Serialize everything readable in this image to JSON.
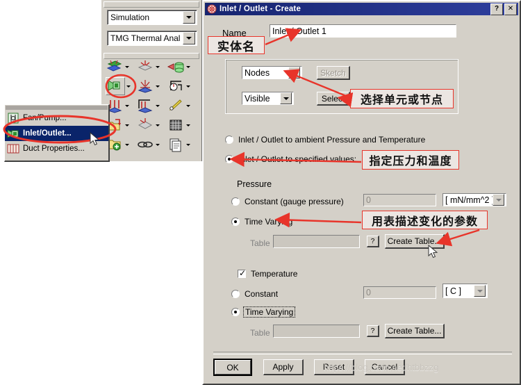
{
  "background_app": {
    "selector_combos": [
      {
        "name": "application-combo",
        "value": "Simulation"
      },
      {
        "name": "solver-combo",
        "value": "TMG Thermal Anal"
      }
    ],
    "toolbar_icons": [
      "thermal-coupling-icon",
      "radiation-icon",
      "fluid-domain-icon",
      "inlet-outlet-icon",
      "fan-pump-icon",
      "duct-flow-icon",
      "boundary-condition-icon",
      "thermal-load-icon",
      "edit-tool-icon",
      "folder-open-icon",
      "mesh-icon",
      "grid-icon",
      "add-folder-icon",
      "link-icon",
      "document-icon"
    ]
  },
  "context_menu": {
    "name": "flow-boundary-conditions-menu",
    "items": [
      {
        "label": "Fan/Pump...",
        "icon": "fan-pump-icon",
        "selected": false
      },
      {
        "label": "Inlet/Outlet...",
        "icon": "inlet-outlet-icon",
        "selected": true
      },
      {
        "label": "Duct Properties...",
        "icon": "duct-properties-icon",
        "selected": false
      }
    ]
  },
  "dialog": {
    "title": "Inlet / Outlet - Create",
    "title_icon": "inlet-outlet-icon",
    "titlebar_buttons": [
      {
        "name": "help-button",
        "label": "?"
      },
      {
        "name": "close-button",
        "label": "✕"
      }
    ],
    "name_field": {
      "label": "Name",
      "value": "Inlet / Outlet 1"
    },
    "selection_group": {
      "entity_type_combo": {
        "value": "Nodes"
      },
      "visibility_combo": {
        "value": "Visible"
      },
      "sketch_button": {
        "label": "Sketch",
        "enabled": false
      },
      "select_button": {
        "label": "Select",
        "enabled": true
      }
    },
    "mode_radios": [
      {
        "label": "Inlet / Outlet to ambient Pressure and Temperature",
        "checked": false
      },
      {
        "label": "Inlet / Outlet to specified values:",
        "checked": true
      }
    ],
    "pressure_section": {
      "title": "Pressure",
      "constant_radio": {
        "label": "Constant (gauge pressure)",
        "checked": false
      },
      "constant_value": "0",
      "unit": "[ mN/mm^2 ]",
      "time_varying_radio": {
        "label": "Time Varying",
        "checked": true
      },
      "table_label": "Table",
      "table_value": "",
      "help_button": "?",
      "create_table_button": "Create Table..."
    },
    "temperature_section": {
      "checkbox": {
        "label": "Temperature",
        "checked": true
      },
      "constant_radio": {
        "label": "Constant",
        "checked": false
      },
      "constant_value": "0",
      "unit": "[ C ]",
      "time_varying_radio": {
        "label": "Time Varying",
        "checked": true
      },
      "table_label": "Table",
      "table_value": "",
      "help_button": "?",
      "create_table_button": "Create Table..."
    },
    "footer_buttons": [
      {
        "name": "ok-button",
        "label": "OK",
        "default": true
      },
      {
        "name": "apply-button",
        "label": "Apply",
        "default": false
      },
      {
        "name": "reset-button",
        "label": "Reset",
        "default": false
      },
      {
        "name": "cancel-button",
        "label": "Cancel",
        "default": false
      }
    ]
  },
  "annotations": [
    {
      "name": "annotation-entity-name",
      "text": "实体名"
    },
    {
      "name": "annotation-select-elements-nodes",
      "text": "选择单元或节点"
    },
    {
      "name": "annotation-specify-pressure-temperature",
      "text": "指定压力和温度"
    },
    {
      "name": "annotation-table-describes-varying-params",
      "text": "用表描述变化的参数"
    }
  ],
  "watermark": {
    "text": "https://blog.csdn.net/htbbzzg"
  },
  "colors": {
    "dialog_face": "#d4d0c8",
    "titlebar": "#16246f",
    "menu_selection": "#0a246a",
    "annotation_red": "#e8342a"
  }
}
